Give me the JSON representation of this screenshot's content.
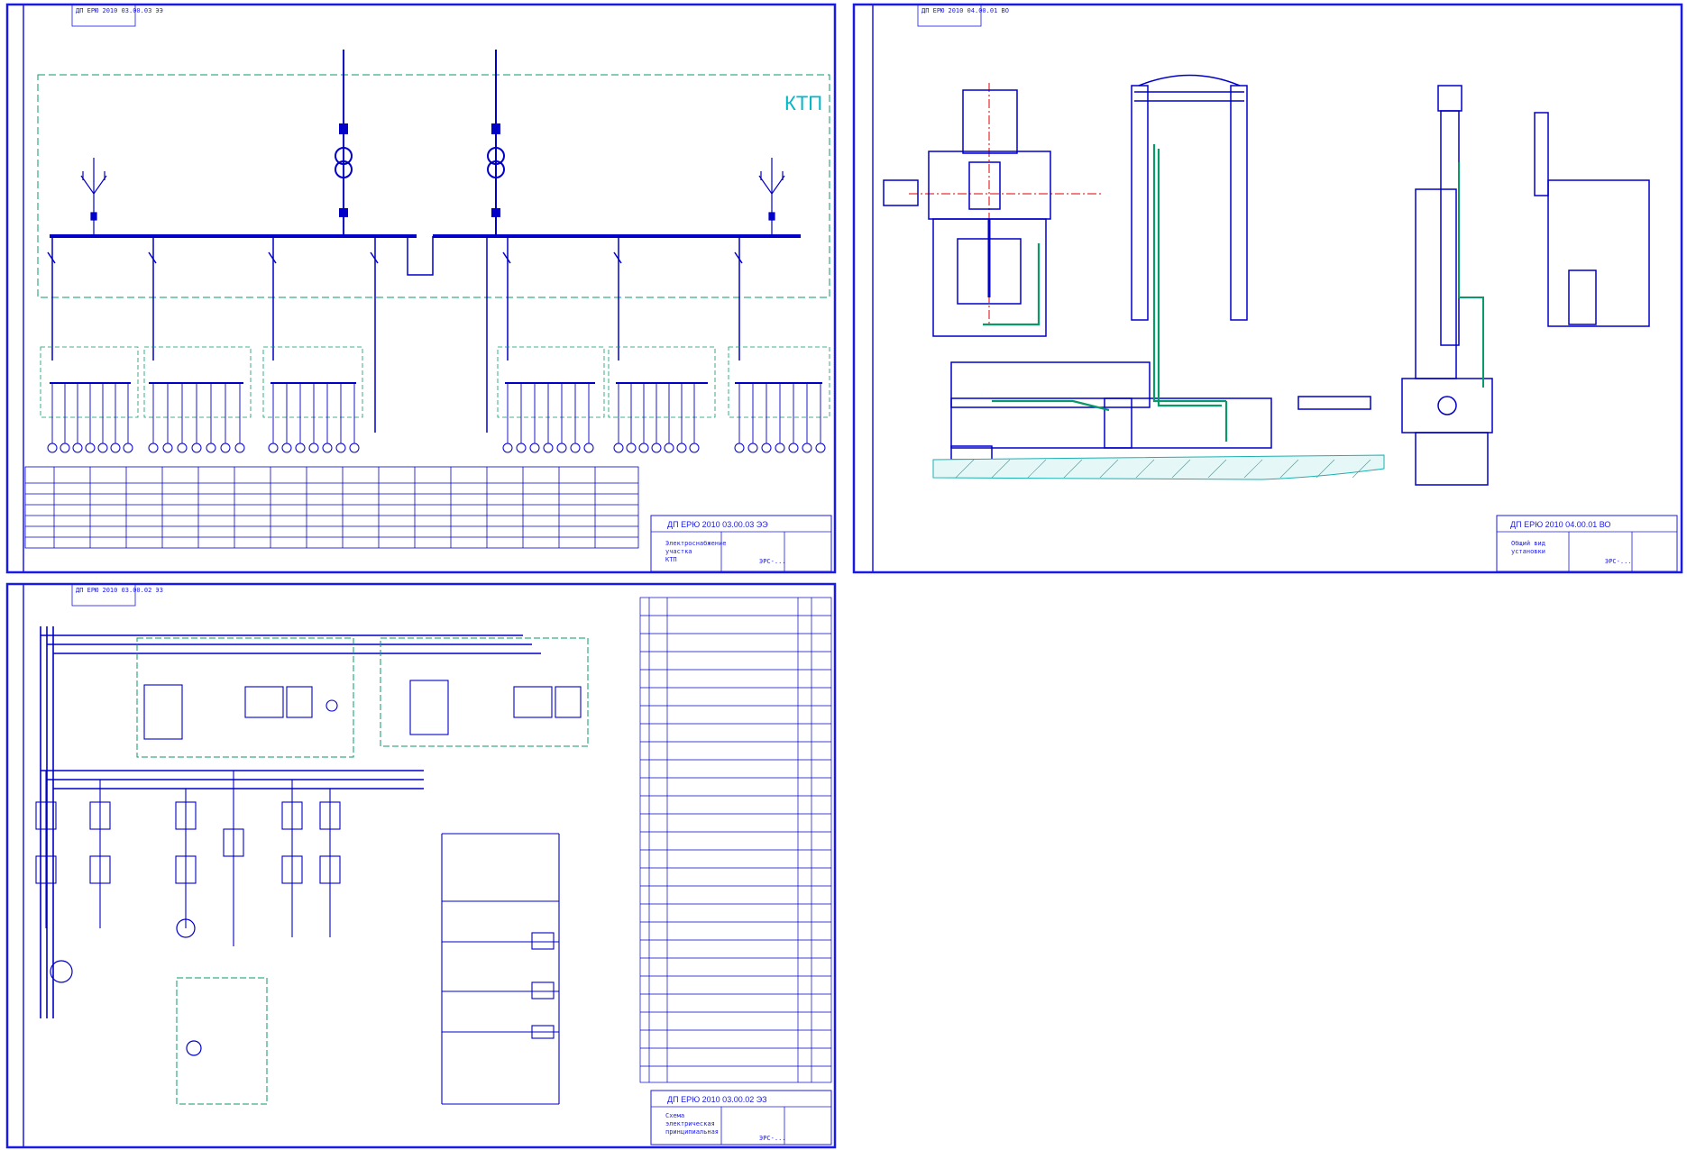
{
  "colors": {
    "frame": "#1a1ae6",
    "line": "#0000c8",
    "accent": "#00b8c8",
    "hydraulic": "#0a9a6a",
    "axis": "#e00000",
    "hatch": "#1ab0b0",
    "paper": "#ffffff"
  },
  "sheets": {
    "single_line": {
      "corner_codes": [
        "ДП ЕРЮ 2010 03.00.03 ЭЭ"
      ],
      "ktp_label": "КТП",
      "title_block": {
        "code": "ДП ЕРЮ 2010 03.00.03 ЭЭ",
        "lines": [
          "Электроснабжение",
          "участка",
          "КТП"
        ],
        "org": "ЭРС-..."
      }
    },
    "mechanical": {
      "corner_codes": [
        "ДП ЕРЮ 2010 04.00.01 ВО"
      ],
      "title_block": {
        "code": "ДП ЕРЮ 2010 04.00.01 ВО",
        "lines": [
          "Общий вид",
          "установки"
        ],
        "org": "ЭРС-..."
      }
    },
    "control": {
      "corner_codes": [
        "ДП ЕРЮ 2010 03.00.02 ЭЗ"
      ],
      "title_block": {
        "code": "ДП ЕРЮ 2010 03.00.02 ЭЗ",
        "lines": [
          "Схема",
          "электрическая",
          "принципиальная"
        ],
        "org": "ЭРС-..."
      }
    }
  }
}
